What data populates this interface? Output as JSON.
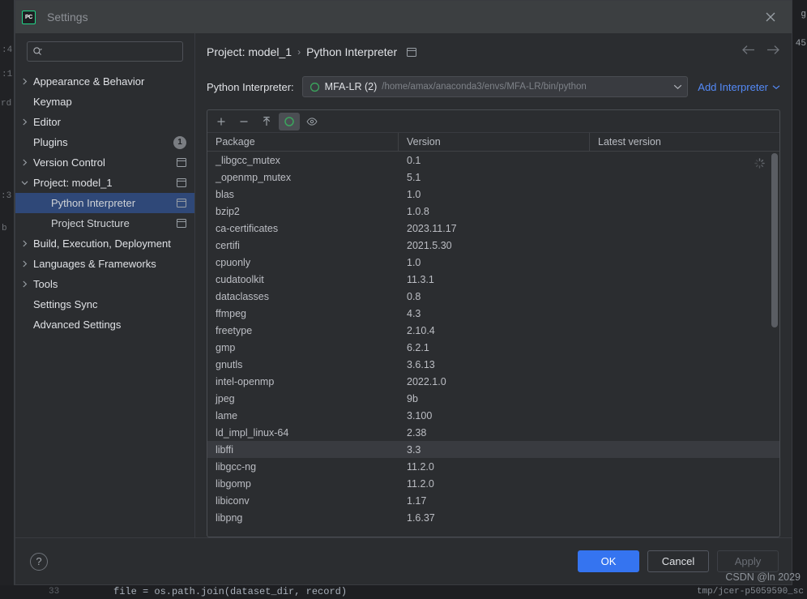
{
  "window": {
    "title": "Settings",
    "logo_text": "PC",
    "logo_icon": "pycharm-logo-icon",
    "close_icon": "close-icon"
  },
  "search": {
    "placeholder": "",
    "value": "",
    "icon": "search-icon"
  },
  "sidebar": {
    "items": [
      {
        "label": "Appearance & Behavior",
        "arrow": "chevron-right-icon",
        "level": 0,
        "selected": false,
        "scope_icon": false,
        "badge": null
      },
      {
        "label": "Keymap",
        "arrow": null,
        "level": 0,
        "selected": false,
        "scope_icon": false,
        "badge": null
      },
      {
        "label": "Editor",
        "arrow": "chevron-right-icon",
        "level": 0,
        "selected": false,
        "scope_icon": false,
        "badge": null
      },
      {
        "label": "Plugins",
        "arrow": null,
        "level": 0,
        "selected": false,
        "scope_icon": false,
        "badge": "1"
      },
      {
        "label": "Version Control",
        "arrow": "chevron-right-icon",
        "level": 0,
        "selected": false,
        "scope_icon": true,
        "badge": null
      },
      {
        "label": "Project: model_1",
        "arrow": "chevron-down-icon",
        "level": 0,
        "selected": false,
        "scope_icon": true,
        "badge": null
      },
      {
        "label": "Python Interpreter",
        "arrow": null,
        "level": 1,
        "selected": true,
        "scope_icon": true,
        "badge": null
      },
      {
        "label": "Project Structure",
        "arrow": null,
        "level": 1,
        "selected": false,
        "scope_icon": true,
        "badge": null
      },
      {
        "label": "Build, Execution, Deployment",
        "arrow": "chevron-right-icon",
        "level": 0,
        "selected": false,
        "scope_icon": false,
        "badge": null
      },
      {
        "label": "Languages & Frameworks",
        "arrow": "chevron-right-icon",
        "level": 0,
        "selected": false,
        "scope_icon": false,
        "badge": null
      },
      {
        "label": "Tools",
        "arrow": "chevron-right-icon",
        "level": 0,
        "selected": false,
        "scope_icon": false,
        "badge": null
      },
      {
        "label": "Settings Sync",
        "arrow": null,
        "level": 0,
        "selected": false,
        "scope_icon": false,
        "badge": null
      },
      {
        "label": "Advanced Settings",
        "arrow": null,
        "level": 0,
        "selected": false,
        "scope_icon": false,
        "badge": null
      }
    ]
  },
  "breadcrumb": {
    "crumb1": "Project: model_1",
    "separator": "›",
    "crumb2": "Python Interpreter",
    "scope_icon": "project-scope-icon",
    "back_icon": "arrow-left-icon",
    "forward_icon": "arrow-right-icon"
  },
  "interpreter": {
    "label": "Python Interpreter:",
    "env_icon": "conda-env-icon",
    "name": "MFA-LR (2)",
    "path": "/home/amax/anaconda3/envs/MFA-LR/bin/python",
    "chevron_icon": "chevron-down-icon",
    "add_label": "Add Interpreter",
    "add_chevron_icon": "chevron-down-icon",
    "accent_color": "#548af7"
  },
  "package_toolbar": {
    "buttons": [
      {
        "name": "add-package-button",
        "icon": "plus-icon",
        "active": false
      },
      {
        "name": "remove-package-button",
        "icon": "minus-icon",
        "active": false
      },
      {
        "name": "upgrade-package-button",
        "icon": "arrow-up-icon",
        "active": false
      },
      {
        "name": "conda-env-button",
        "icon": "conda-circle-icon",
        "active": true
      },
      {
        "name": "show-early-releases-button",
        "icon": "eye-icon",
        "active": false
      }
    ]
  },
  "package_table": {
    "columns": [
      "Package",
      "Version",
      "Latest version"
    ],
    "loading_indicator": "loading-spinner-icon",
    "hovered_row_package": "libffi",
    "rows": [
      {
        "package": "_libgcc_mutex",
        "version": "0.1",
        "latest": ""
      },
      {
        "package": "_openmp_mutex",
        "version": "5.1",
        "latest": ""
      },
      {
        "package": "blas",
        "version": "1.0",
        "latest": ""
      },
      {
        "package": "bzip2",
        "version": "1.0.8",
        "latest": ""
      },
      {
        "package": "ca-certificates",
        "version": "2023.11.17",
        "latest": ""
      },
      {
        "package": "certifi",
        "version": "2021.5.30",
        "latest": ""
      },
      {
        "package": "cpuonly",
        "version": "1.0",
        "latest": ""
      },
      {
        "package": "cudatoolkit",
        "version": "11.3.1",
        "latest": ""
      },
      {
        "package": "dataclasses",
        "version": "0.8",
        "latest": ""
      },
      {
        "package": "ffmpeg",
        "version": "4.3",
        "latest": ""
      },
      {
        "package": "freetype",
        "version": "2.10.4",
        "latest": ""
      },
      {
        "package": "gmp",
        "version": "6.2.1",
        "latest": ""
      },
      {
        "package": "gnutls",
        "version": "3.6.13",
        "latest": ""
      },
      {
        "package": "intel-openmp",
        "version": "2022.1.0",
        "latest": ""
      },
      {
        "package": "jpeg",
        "version": "9b",
        "latest": ""
      },
      {
        "package": "lame",
        "version": "3.100",
        "latest": ""
      },
      {
        "package": "ld_impl_linux-64",
        "version": "2.38",
        "latest": ""
      },
      {
        "package": "libffi",
        "version": "3.3",
        "latest": ""
      },
      {
        "package": "libgcc-ng",
        "version": "11.2.0",
        "latest": ""
      },
      {
        "package": "libgomp",
        "version": "11.2.0",
        "latest": ""
      },
      {
        "package": "libiconv",
        "version": "1.17",
        "latest": ""
      },
      {
        "package": "libpng",
        "version": "1.6.37",
        "latest": ""
      }
    ]
  },
  "footer": {
    "help_label": "?",
    "ok_label": "OK",
    "cancel_label": "Cancel",
    "apply_label": "Apply",
    "primary_color": "#3574f0"
  },
  "watermark": {
    "text": "CSDN @ln 2029"
  },
  "backdrop": {
    "left_fragments": [
      ":4",
      ":1",
      "rd",
      ":3",
      "b"
    ],
    "right_fragments": [
      "g",
      "45"
    ],
    "bottom_line_number": "33",
    "bottom_code": "file = os.path.join(dataset_dir, record)",
    "bottom_tab": "tmp/jcer-p5059590_sc"
  }
}
